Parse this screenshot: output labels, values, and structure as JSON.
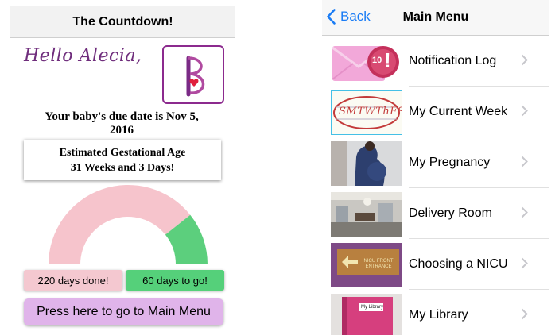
{
  "countdown": {
    "title": "The Countdown!",
    "greeting": "Hello Alecia,",
    "due_date_line1": "Your baby's due date is Nov 5,",
    "due_date_line2": "2016",
    "ga_heading": "Estimated Gestational Age",
    "ga_value": "31 Weeks and 3 Days!",
    "days_done": "220 days done!",
    "days_to_go": "60 days to go!",
    "progress_fraction": 0.786,
    "gauge_colors": {
      "done": "#f6c4cc",
      "to_go": "#5ccf7d"
    },
    "main_menu_button": "Press here to go to Main Menu"
  },
  "main_menu": {
    "back_label": "Back",
    "title": "Main Menu",
    "items": [
      {
        "label": "Notification Log",
        "icon": "envelope-alert-icon",
        "badge": "10"
      },
      {
        "label": "My Current Week",
        "icon": "weekday-calendar-icon",
        "thumb_text": "SMTWThFS"
      },
      {
        "label": "My Pregnancy",
        "icon": "pregnant-woman-photo"
      },
      {
        "label": "Delivery Room",
        "icon": "delivery-room-photo"
      },
      {
        "label": "Choosing a NICU",
        "icon": "nicu-entrance-photo",
        "thumb_text": "NICU FRONT ENTRANCE"
      },
      {
        "label": "My Library",
        "icon": "library-binder-photo",
        "thumb_text": "My Library"
      }
    ]
  }
}
